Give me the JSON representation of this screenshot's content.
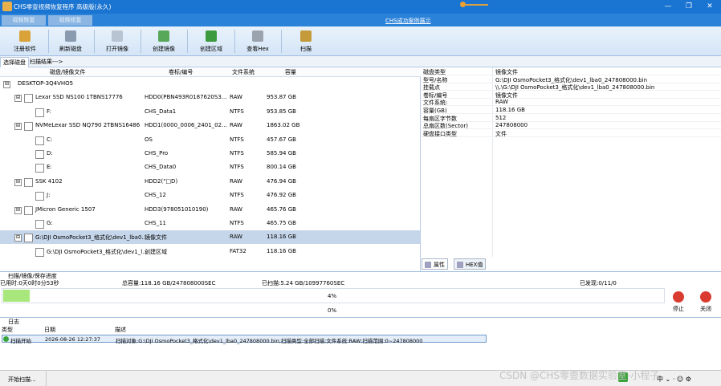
{
  "window": {
    "title": "CHS零壹视频恢复程序 高级版(永久)",
    "min": "—",
    "restore": "❐",
    "close": "✕"
  },
  "top_tabs": [
    "视频恢复",
    "视频修复"
  ],
  "demo_link": "CHS成功案例展示",
  "toolbar": [
    {
      "label": "注册软件",
      "icon": "register-icon",
      "color": "#d9a33a"
    },
    {
      "label": "刷新磁盘",
      "icon": "refresh-disk-icon",
      "color": "#8a9bb0"
    },
    {
      "label": "打开镜像",
      "icon": "open-image-icon",
      "color": "#b8c4d2"
    },
    {
      "label": "创建镜像",
      "icon": "create-image-icon",
      "color": "#58a85a"
    },
    {
      "label": "创建区域",
      "icon": "create-region-icon",
      "color": "#3d9a3f"
    },
    {
      "label": "查看Hex",
      "icon": "hex-view-icon",
      "color": "#9aa3ae"
    },
    {
      "label": "扫描",
      "icon": "scan-icon",
      "color": "#c49a3a"
    }
  ],
  "sub_tabs": [
    "选择磁盘",
    "扫描结果--->"
  ],
  "tree": {
    "headers": [
      "磁盘/镜像文件",
      "卷标/编号",
      "文件系统",
      "容量"
    ],
    "rows": [
      {
        "indent": 0,
        "expander": "⊟",
        "checkbox": false,
        "name": "DESKTOP-3Q4VHO5",
        "label": "",
        "fs": "",
        "size": "",
        "sel": false
      },
      {
        "indent": 1,
        "expander": "⊟",
        "checkbox": true,
        "name": "Lexar SSD NS100 1TBNS17776",
        "label": "HDD0(PBN493R0187620S3...",
        "fs": "RAW",
        "size": "953.87 GB",
        "sel": false
      },
      {
        "indent": 2,
        "expander": "",
        "checkbox": true,
        "name": "F:",
        "label": "CHS_Data1",
        "fs": "NTFS",
        "size": "953.85 GB",
        "sel": false
      },
      {
        "indent": 1,
        "expander": "⊟",
        "checkbox": true,
        "name": "NVMeLexar SSD NQ790 2TBNS16486",
        "label": "HDD1(0000_0006_2401_02...",
        "fs": "RAW",
        "size": "1863.02 GB",
        "sel": false
      },
      {
        "indent": 2,
        "expander": "",
        "checkbox": true,
        "name": "C:",
        "label": "OS",
        "fs": "NTFS",
        "size": "457.67 GB",
        "sel": false
      },
      {
        "indent": 2,
        "expander": "",
        "checkbox": true,
        "name": "D:",
        "label": "CHS_Pro",
        "fs": "NTFS",
        "size": "585.94 GB",
        "sel": false
      },
      {
        "indent": 2,
        "expander": "",
        "checkbox": true,
        "name": "E:",
        "label": "CHS_Data0",
        "fs": "NTFS",
        "size": "800.14 GB",
        "sel": false
      },
      {
        "indent": 1,
        "expander": "⊟",
        "checkbox": true,
        "name": "SSK                4102",
        "label": "HDD2(\"□D)",
        "fs": "RAW",
        "size": "476.94 GB",
        "sel": false
      },
      {
        "indent": 2,
        "expander": "",
        "checkbox": true,
        "name": "J:",
        "label": "CHS_12",
        "fs": "NTFS",
        "size": "476.92 GB",
        "sel": false
      },
      {
        "indent": 1,
        "expander": "⊟",
        "checkbox": true,
        "name": "JMicron Generic          1507",
        "label": "HDD3(978051010190)",
        "fs": "RAW",
        "size": "465.76 GB",
        "sel": false
      },
      {
        "indent": 2,
        "expander": "",
        "checkbox": true,
        "name": "G:",
        "label": "CHS_11",
        "fs": "NTFS",
        "size": "465.75 GB",
        "sel": false
      },
      {
        "indent": 1,
        "expander": "⊟",
        "checkbox": true,
        "name": "G:\\DJI OsmoPocket3_格式化\\dev1_lba0...",
        "label": "镜像文件",
        "fs": "RAW",
        "size": "118.16 GB",
        "sel": true
      },
      {
        "indent": 2,
        "expander": "",
        "checkbox": true,
        "name": "G:\\DJI OsmoPocket3_格式化\\dev1_l...",
        "label": "创建区域",
        "fs": "FAT32",
        "size": "118.16 GB",
        "sel": false
      }
    ]
  },
  "properties": [
    {
      "k": "磁盘类型",
      "v": "镜像文件"
    },
    {
      "k": "型号/名称",
      "v": "G:\\DJI OsmoPocket3_格式化\\dev1_lba0_247808000.bin"
    },
    {
      "k": "挂载点",
      "v": "\\\\.\\G:\\DJI OsmoPocket3_格式化\\dev1_lba0_247808000.bin"
    },
    {
      "k": "卷标/编号",
      "v": "镜像文件"
    },
    {
      "k": "文件系统:",
      "v": "RAW"
    },
    {
      "k": "容量(GB)",
      "v": "118.16 GB"
    },
    {
      "k": "每扇区字节数",
      "v": "512"
    },
    {
      "k": "总扇区数(Sector)",
      "v": "247808000"
    },
    {
      "k": "硬盘接口类型",
      "v": "文件"
    }
  ],
  "bottom_tabs": [
    "属性",
    "HEX值"
  ],
  "progress": {
    "title": "扫描/镜像/保存进度",
    "elapsed": "已用时:0天0时0分53秒",
    "total": "总容量:118.16 GB/247808000SEC",
    "scanned": "已扫描:5.24 GB/10997760SEC",
    "found": "已发现:0/11/0",
    "percent1": "4%",
    "percent2": "0%",
    "fill_fraction": 0.04,
    "stop_label": "停止",
    "close_label": "关闭"
  },
  "log": {
    "title": "日志",
    "headers": [
      "类型",
      "日期",
      "描述"
    ],
    "entries": [
      {
        "type": "扫描开始",
        "date": "2026-08-26 12:27:37",
        "desc": "扫描对象:G:\\DJI OsmoPocket3_格式化\\dev1_lba0_247808000.bin;扫描类型:全部扫描;文件系统:RAW;扫描范围:0~247808000"
      }
    ]
  },
  "status": {
    "text": "开始扫描...",
    "tray": "中 ⌄ ⋅ ☺ ⚙"
  },
  "watermark": "CSDN @CHS零壹数据实验室-小程子"
}
